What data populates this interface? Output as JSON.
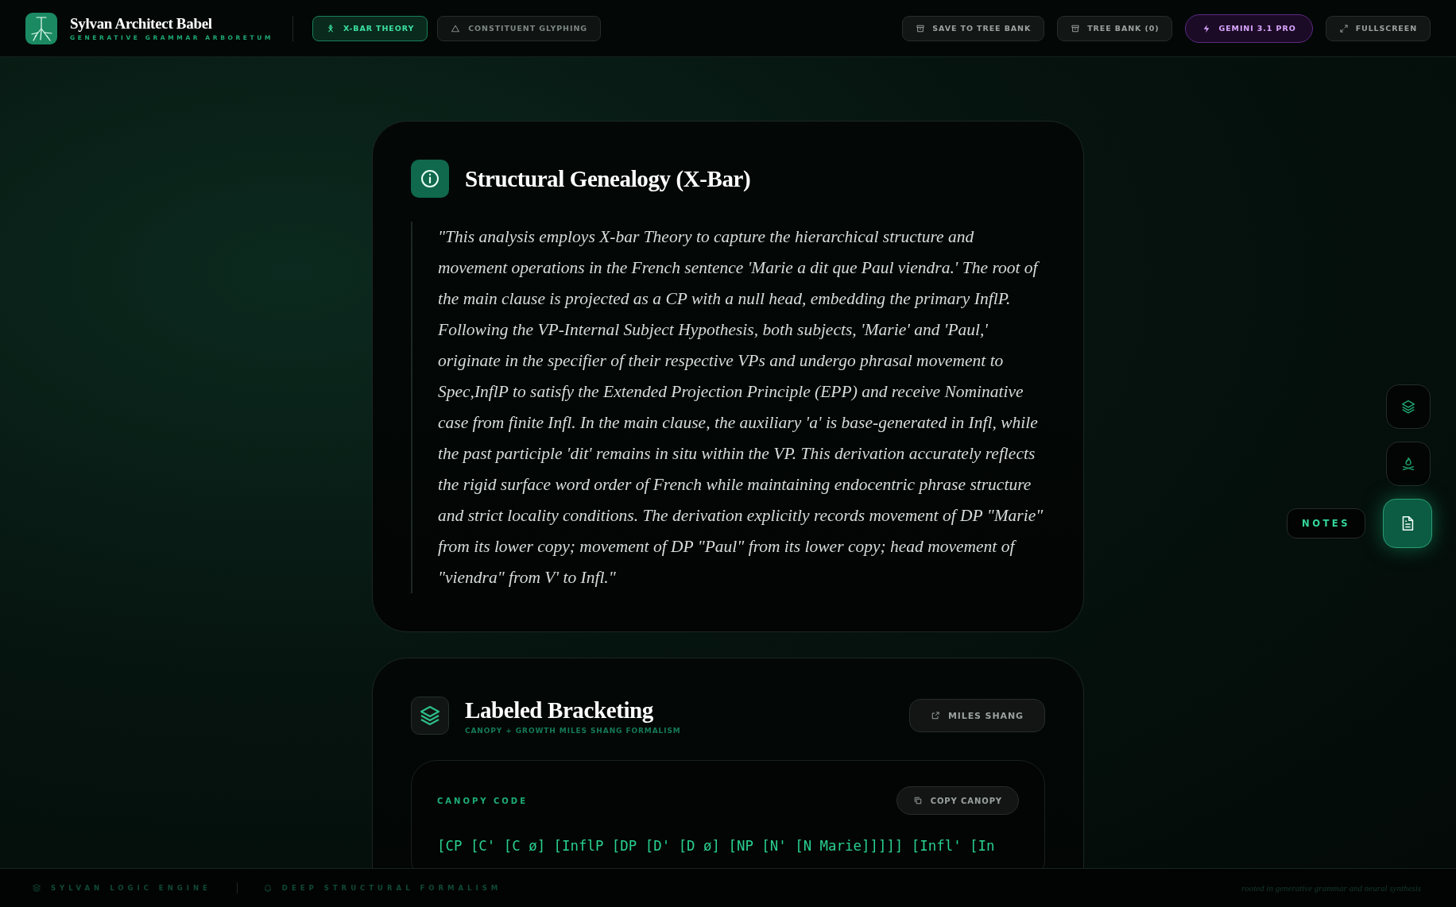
{
  "brand": {
    "title": "Sylvan Architect Babel",
    "subtitle": "GENERATIVE GRAMMAR ARBORETUM"
  },
  "nav_tabs": [
    {
      "label": "X-BAR THEORY",
      "selected": true
    },
    {
      "label": "CONSTITUENT GLYPHING",
      "selected": false
    }
  ],
  "actions": [
    {
      "label": "SAVE TO TREE BANK",
      "kind": "plain"
    },
    {
      "label": "TREE BANK (0)",
      "kind": "plain"
    },
    {
      "label": "GEMINI 3.1 PRO",
      "kind": "model"
    },
    {
      "label": "FULLSCREEN",
      "kind": "plain"
    }
  ],
  "genealogy": {
    "title": "Structural Genealogy (X-Bar)",
    "text": "\"This analysis employs X-bar Theory to capture the hierarchical structure and movement operations in the French sentence 'Marie a dit que Paul viendra.' The root of the main clause is projected as a CP with a null head, embedding the primary InflP. Following the VP-Internal Subject Hypothesis, both subjects, 'Marie' and 'Paul,' originate in the specifier of their respective VPs and undergo phrasal movement to Spec,InflP to satisfy the Extended Projection Principle (EPP) and receive Nominative case from finite Infl. In the main clause, the auxiliary 'a' is base-generated in Infl, while the past participle 'dit' remains in situ within the VP. This derivation accurately reflects the rigid surface word order of French while maintaining endocentric phrase structure and strict locality conditions. The derivation explicitly records movement of DP \"Marie\" from its lower copy; movement of DP \"Paul\" from its lower copy; head movement of \"viendra\" from V' to Infl.\""
  },
  "bracketing": {
    "title": "Labeled Bracketing",
    "subtitle": "CANOPY + GROWTH MILES SHANG FORMALISM",
    "link": "MILES SHANG",
    "code_label": "CANOPY CODE",
    "copy": "COPY CANOPY",
    "code": "[CP [C' [C ø] [InflP [DP [D' [D ø] [NP [N' [N Marie]]]]] [Infl' [In"
  },
  "side_rail": [
    {
      "selected": false
    },
    {
      "selected": false
    },
    {
      "selected": true,
      "label": "NOTES"
    }
  ],
  "footer": {
    "left": [
      "SYLVAN LOGIC ENGINE",
      "DEEP STRUCTURAL FORMALISM"
    ],
    "right": "rooted in generative grammar and neural synthesis"
  }
}
